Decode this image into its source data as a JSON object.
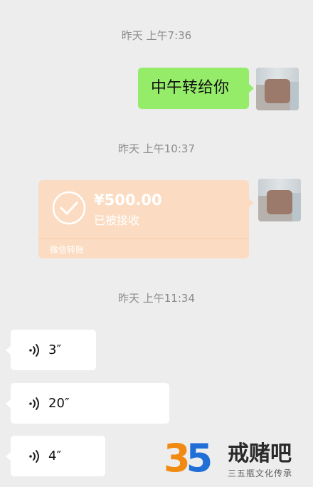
{
  "messages": {
    "ts1": "昨天 上午7:36",
    "text_msg": "中午转给你",
    "ts2": "昨天 上午10:37",
    "transfer": {
      "amount": "¥500.00",
      "status": "已被接收",
      "label": "微信转账",
      "color": "#fbdcc2"
    },
    "ts3": "昨天 上午11:34",
    "voices": [
      {
        "duration": "3″"
      },
      {
        "duration": "20″"
      },
      {
        "duration": "4″"
      }
    ]
  },
  "watermark": {
    "number_first": "3",
    "number_second": "5",
    "brand": "戒赌吧",
    "tagline": "三五瓶文化传承"
  },
  "colors": {
    "background": "#ededed",
    "my_bubble": "#95ec69",
    "voice_bubble": "#ffffff",
    "timestamp": "#8c8c8c"
  }
}
